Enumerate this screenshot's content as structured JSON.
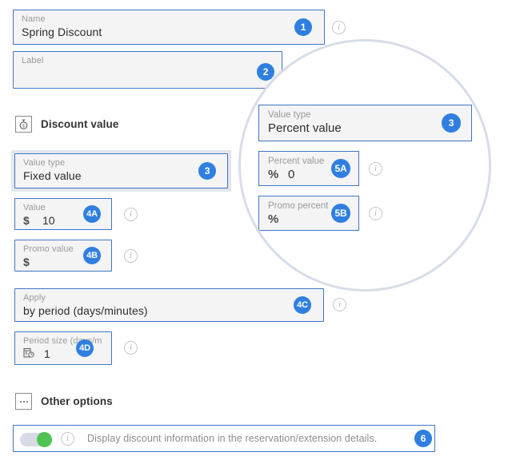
{
  "colors": {
    "badge_blue": "#2f7fe0",
    "field_border_blue": "#3f76c4",
    "field_bg": "#f4f4f4",
    "halo_gray_blue": "#e2e6ed",
    "magnifier_border": "#d7dde8",
    "toggle_on_green": "#4fc252",
    "label_gray": "#9a9a9a"
  },
  "form": {
    "name_field": {
      "label": "Name",
      "value": "Spring Discount",
      "badge": "1",
      "has_info": true
    },
    "label_field": {
      "label": "Label",
      "value": "",
      "placeholder": "",
      "badge": "2",
      "has_info": false
    }
  },
  "discount_section": {
    "title": "Discount value",
    "icon": "discount-tag-icon",
    "value_type_field": {
      "label": "Value type",
      "value": "Fixed value",
      "badge": "3",
      "selected": true
    },
    "value_field": {
      "label": "Value",
      "symbol": "$",
      "value": "10",
      "badge": "4A",
      "has_info": true
    },
    "promo_value_field": {
      "label": "Promo value",
      "symbol": "$",
      "value": "",
      "badge": "4B",
      "has_info": true
    },
    "apply_field": {
      "label": "Apply",
      "value": "by period (days/minutes)",
      "badge": "4C",
      "has_info": true
    },
    "period_size_field": {
      "label": "Period size (days/m",
      "icon": "calendar-clock-icon",
      "value": "1",
      "badge": "4D",
      "has_info": true
    }
  },
  "magnifier": {
    "value_type_field": {
      "label": "Value type",
      "value": "Percent value",
      "badge": "3"
    },
    "percent_value_field": {
      "label": "Percent value",
      "symbol": "%",
      "value": "0",
      "badge": "5A",
      "has_info": true
    },
    "promo_percent_field": {
      "label": "Promo percent",
      "symbol": "%",
      "value": "",
      "badge": "5B",
      "has_info": true
    }
  },
  "other_options": {
    "title": "Other options",
    "icon": "ellipsis-box-icon",
    "toggle": {
      "state": "on",
      "text": "Display discount information in the reservation/extension details.",
      "badge": "6",
      "has_info": true
    }
  }
}
